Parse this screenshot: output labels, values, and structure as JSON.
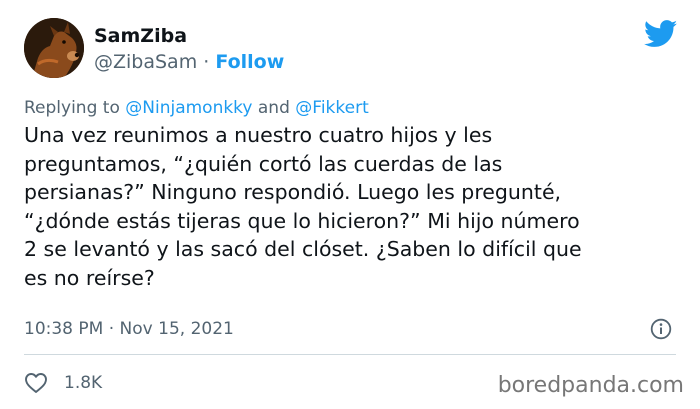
{
  "header": {
    "display_name": "SamZiba",
    "handle": "@ZibaSam",
    "separator": "·",
    "follow_label": "Follow",
    "brand_icon": "twitter-bird-icon"
  },
  "reply": {
    "prefix": "Replying to",
    "mention_1": "@Ninjamonkky",
    "conjunction": "and",
    "mention_2": "@Fikkert"
  },
  "tweet": {
    "lines": [
      "Una vez reunimos a nuestro cuatro hijos y les",
      "preguntamos, “¿quién cortó las cuerdas de las",
      "persianas?” Ninguno respondió. Luego les pregunté,",
      "“¿dónde estás tijeras que lo hicieron?” Mi hijo número",
      "2 se levantó y las sacó del clóset. ¿Saben lo difícil que",
      "es no reírse?"
    ]
  },
  "meta": {
    "time": "10:38 PM",
    "separator": "·",
    "date": "Nov 15, 2021",
    "info_icon": "info-icon"
  },
  "actions": {
    "like_icon": "heart-icon",
    "like_count": "1.8K"
  },
  "watermark": "boredpanda.com",
  "colors": {
    "accent": "#1d9bf0",
    "text": "#0f1419",
    "secondary": "#536471",
    "divider": "#cfd9de"
  }
}
